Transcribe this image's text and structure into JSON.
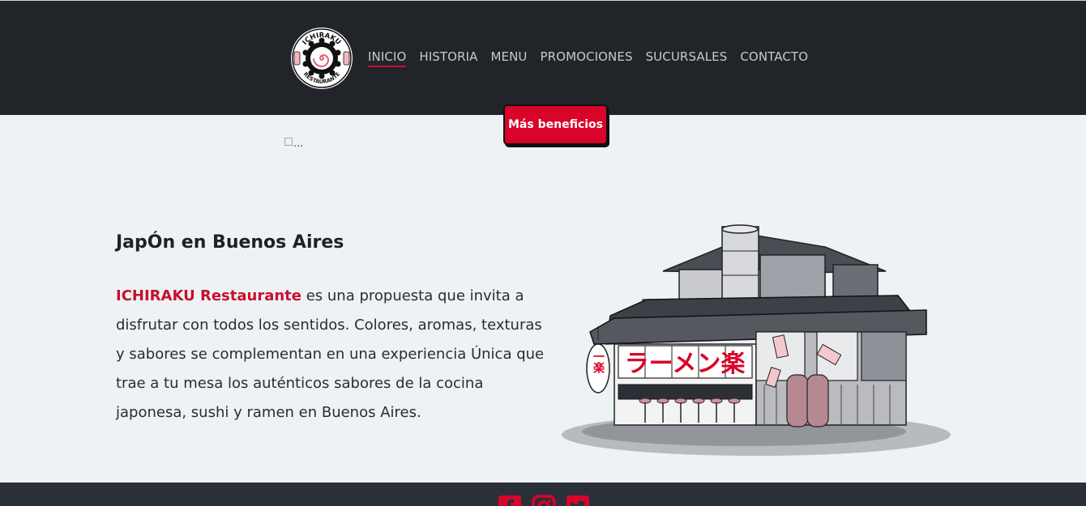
{
  "header": {
    "logo": {
      "top_text": "ICHIRAKU",
      "bottom_text": "RESTAURANTE"
    },
    "nav": [
      {
        "label": "INICIO"
      },
      {
        "label": "HISTORIA"
      },
      {
        "label": "MENU"
      },
      {
        "label": "PROMOCIONES"
      },
      {
        "label": "SUCURSALES"
      },
      {
        "label": "CONTACTO"
      }
    ]
  },
  "benefits_button": "Más beneficios",
  "broken_image_alt": "...",
  "main": {
    "title": "JapÓn en Buenos Aires",
    "brand": "ICHIRAKU Restaurante",
    "description": " es una propuesta que invita a disfrutar con todos los sentidos. Colores, aromas, texturas y sabores se complementan en una experiencia Única que trae a tu mesa los auténticos sabores de la cocina japonesa, sushi y ramen en Buenos Aires."
  },
  "illustration": {
    "sign_text": "ラーメン楽",
    "lantern_text": "一楽"
  },
  "footer": {
    "social_icons": [
      "facebook-icon",
      "instagram-icon",
      "twitter-icon"
    ]
  },
  "colors": {
    "accent": "#d90429",
    "header_bg": "#212429",
    "page_bg": "#edf2f4",
    "footer_bg": "#2b2f38"
  }
}
